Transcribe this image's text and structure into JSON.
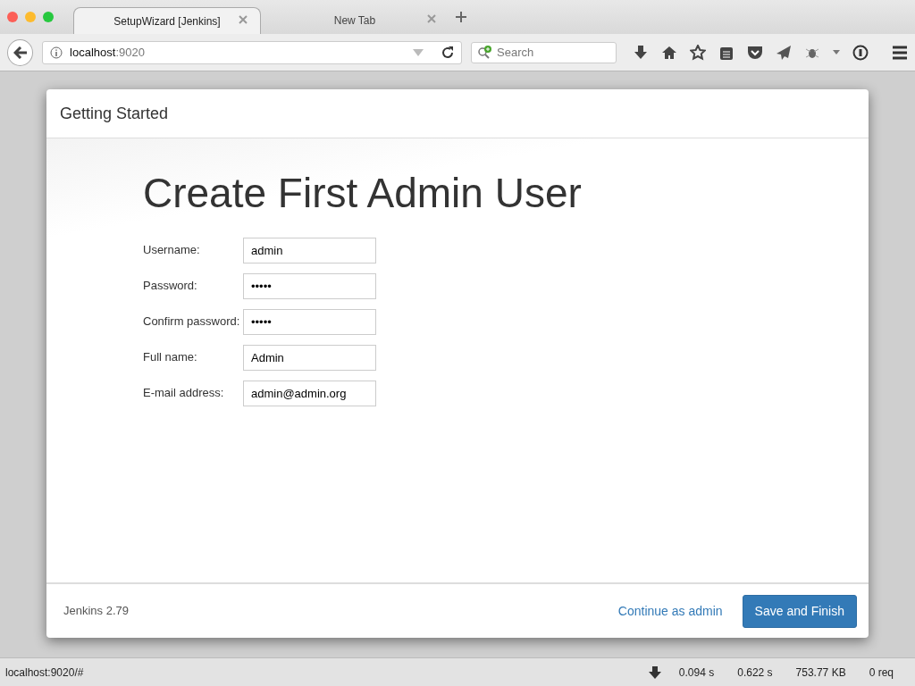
{
  "browser": {
    "tabs": [
      {
        "title": "SetupWizard [Jenkins]",
        "selected": true
      },
      {
        "title": "New Tab",
        "selected": false
      }
    ],
    "address": {
      "host": "localhost",
      "port": ":9020"
    },
    "search": {
      "placeholder": "Search"
    }
  },
  "dialog": {
    "title": "Getting Started",
    "heading": "Create First Admin User",
    "fields": [
      {
        "label": "Username:",
        "value": "admin"
      },
      {
        "label": "Password:",
        "value": "•••••"
      },
      {
        "label": "Confirm password:",
        "value": "•••••"
      },
      {
        "label": "Full name:",
        "value": "Admin"
      },
      {
        "label": "E-mail address:",
        "value": "admin@admin.org"
      }
    ],
    "version": "Jenkins 2.79",
    "link": "Continue as admin",
    "button": "Save and Finish"
  },
  "status_bar": {
    "url": "localhost:9020/#",
    "stats": [
      "0.094 s",
      "0.622 s",
      "753.77 KB",
      "0 req"
    ]
  }
}
